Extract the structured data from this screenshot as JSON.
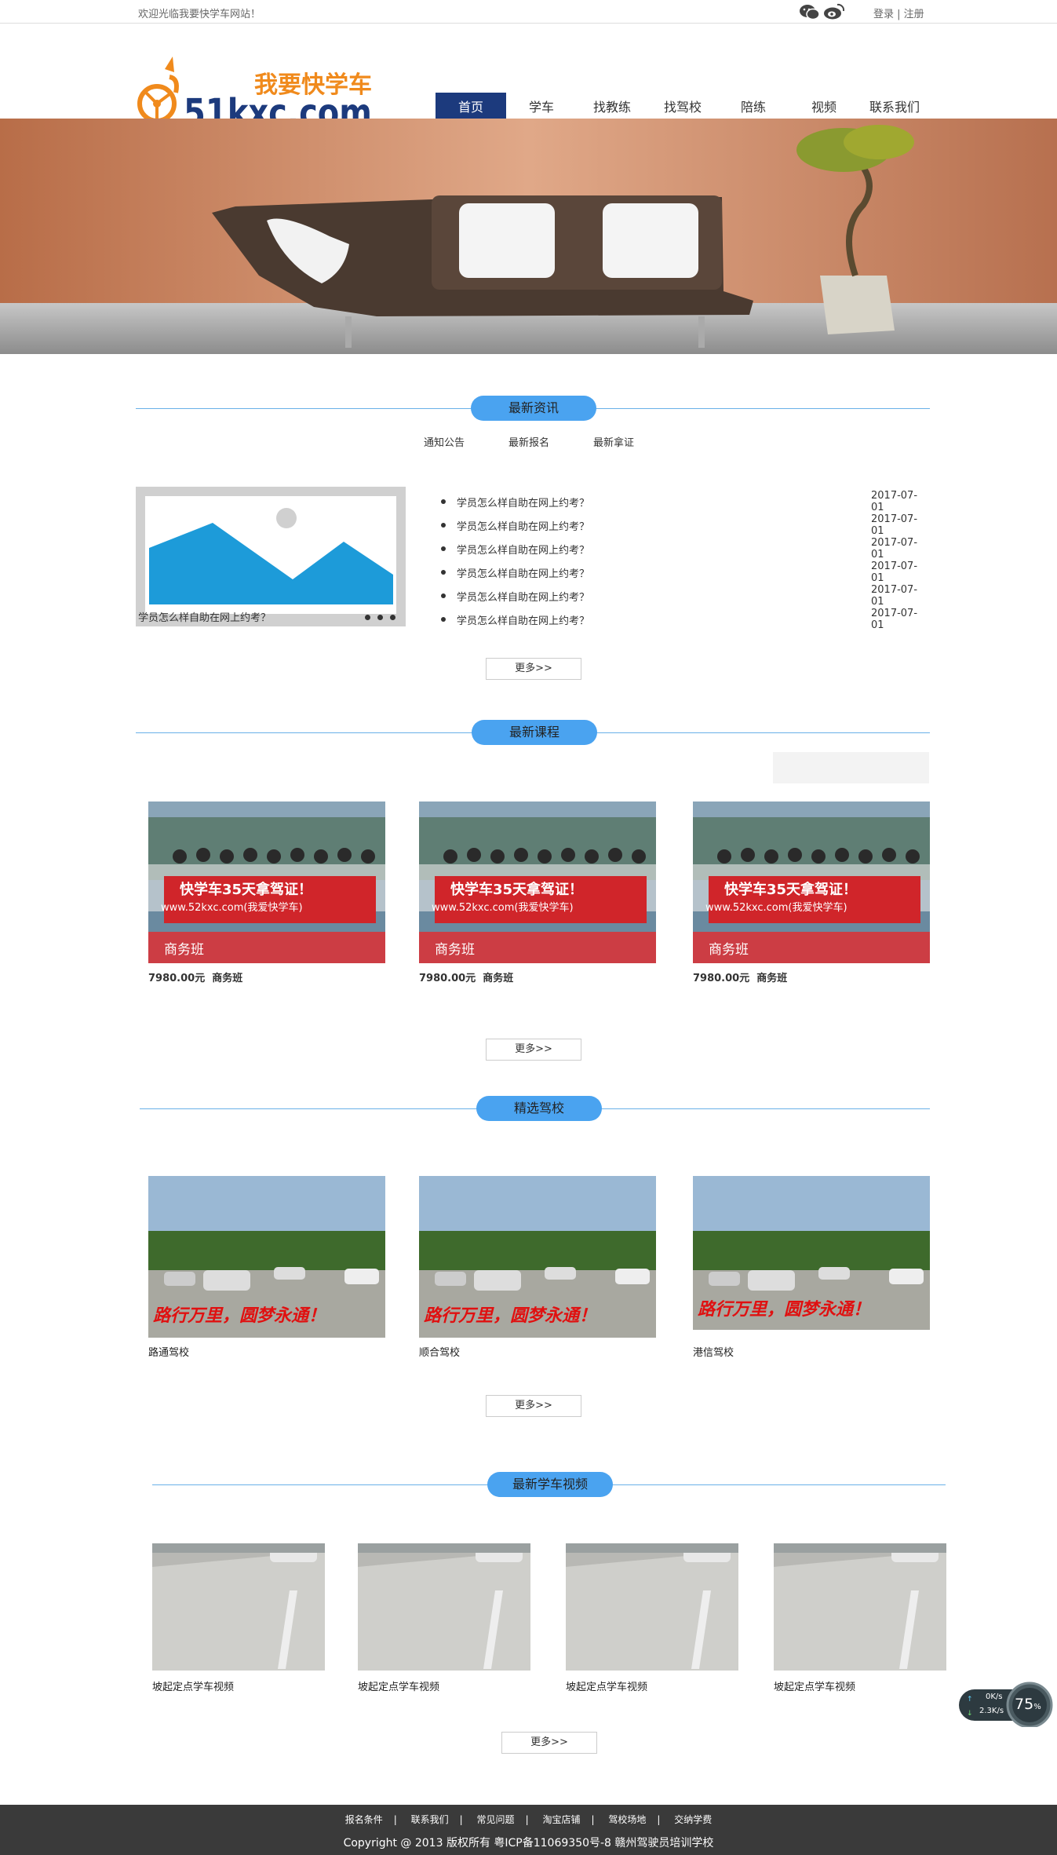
{
  "topbar": {
    "welcome": "欢迎光临我要快学车网站！",
    "login": "登录",
    "register": "注册",
    "sep": " | "
  },
  "logo": {
    "text_cn": "我要快学车",
    "text_en": "51kxc.com"
  },
  "nav": [
    {
      "label": "首页",
      "active": true
    },
    {
      "label": "学车"
    },
    {
      "label": "找教练"
    },
    {
      "label": "找驾校"
    },
    {
      "label": "陪练"
    },
    {
      "label": "视频"
    },
    {
      "label": "联系我们"
    }
  ],
  "sections": {
    "news": {
      "title": "最新资讯",
      "tabs": [
        "通知公告",
        "最新报名",
        "最新拿证"
      ],
      "caption": "学员怎么样自助在网上约考？",
      "items": [
        {
          "title": "学员怎么样自助在网上约考？",
          "date": "2017-07-01"
        },
        {
          "title": "学员怎么样自助在网上约考？",
          "date": "2017-07-01"
        },
        {
          "title": "学员怎么样自助在网上约考？",
          "date": "2017-07-01"
        },
        {
          "title": "学员怎么样自助在网上约考？",
          "date": "2017-07-01"
        },
        {
          "title": "学员怎么样自助在网上约考？",
          "date": "2017-07-01"
        },
        {
          "title": "学员怎么样自助在网上约考？",
          "date": "2017-07-01"
        }
      ],
      "more": "更多>>"
    },
    "courses": {
      "title": "最新课程",
      "items": [
        {
          "price": "7980.00元",
          "name": "商务班",
          "badge": "商务班",
          "banner": "快学车35天拿驾证！",
          "url": "www.52kxc.com(我爱快学车)"
        },
        {
          "price": "7980.00元",
          "name": "商务班",
          "badge": "商务班",
          "banner": "快学车35天拿驾证！",
          "url": "www.52kxc.com(我爱快学车)"
        },
        {
          "price": "7980.00元",
          "name": "商务班",
          "badge": "商务班",
          "banner": "快学车35天拿驾证！",
          "url": "www.52kxc.com(我爱快学车)"
        }
      ],
      "more": "更多>>"
    },
    "schools": {
      "title": "精选驾校",
      "slogan": "路行万里，圆梦永通！",
      "items": [
        {
          "name": "路通驾校"
        },
        {
          "name": "顺合驾校"
        },
        {
          "name": "港信驾校"
        }
      ],
      "more": "更多>>"
    },
    "videos": {
      "title": "最新学车视频",
      "items": [
        {
          "name": "坡起定点学车视频"
        },
        {
          "name": "坡起定点学车视频"
        },
        {
          "name": "坡起定点学车视频"
        },
        {
          "name": "坡起定点学车视频"
        }
      ],
      "more": "更多>>"
    }
  },
  "footer": {
    "links": [
      "报名条件",
      "联系我们",
      "常见问题",
      "淘宝店铺",
      "驾校场地",
      "交纳学费"
    ],
    "copyright": "Copyright @ 2013 版权所有 粤ICP备11069350号-8   赣州驾驶员培训学校"
  },
  "speed_widget": {
    "up": "0K/s",
    "down": "2.3K/s",
    "percent": "75"
  },
  "colors": {
    "accent": "#4aa3f0",
    "nav_active": "#1c3a7d",
    "footer": "#3a3a3a",
    "logo_orange": "#f08a1c",
    "logo_blue": "#1c3a7d"
  }
}
